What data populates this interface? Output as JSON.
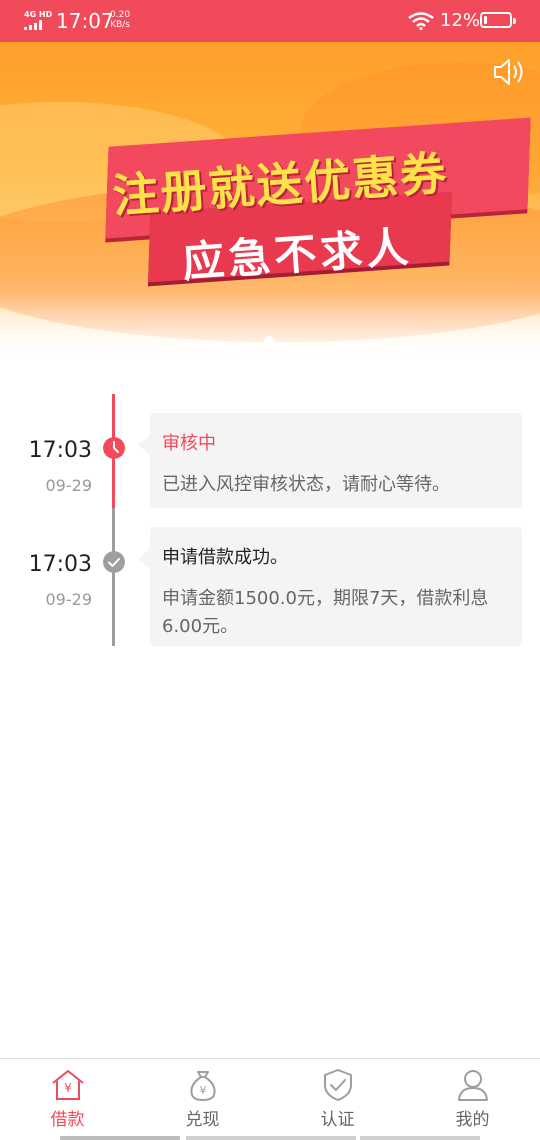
{
  "status_bar": {
    "network": "4G HD",
    "time": "17:07",
    "speed_value": "0.20",
    "speed_unit": "KB/s",
    "battery_percent": "12%",
    "battery_level": 0.12
  },
  "banner": {
    "title": "注册就送优惠券",
    "subtitle": "应急不求人",
    "sound_icon": "speaker-icon",
    "carousel_active_index": 0,
    "carousel_count": 1
  },
  "timeline": {
    "entries": [
      {
        "time": "17:03",
        "date": "09-29",
        "status_icon": "clock-icon",
        "title": "审核中",
        "description": "已进入风控审核状态，请耐心等待。"
      },
      {
        "time": "17:03",
        "date": "09-29",
        "status_icon": "check-icon",
        "title": "申请借款成功。",
        "description": "申请金额1500.0元，期限7天，借款利息6.00元。"
      }
    ]
  },
  "bottom_nav": {
    "items": [
      {
        "label": "借款",
        "icon": "loan-house-icon",
        "active": true
      },
      {
        "label": "兑现",
        "icon": "money-bag-icon",
        "active": false
      },
      {
        "label": "认证",
        "icon": "shield-check-icon",
        "active": false
      },
      {
        "label": "我的",
        "icon": "user-icon",
        "active": false
      }
    ]
  },
  "colors": {
    "accent": "#f04a5b",
    "inactive_gray": "#9e9e9e",
    "text_dark": "#222222",
    "text_gray": "#666666"
  }
}
